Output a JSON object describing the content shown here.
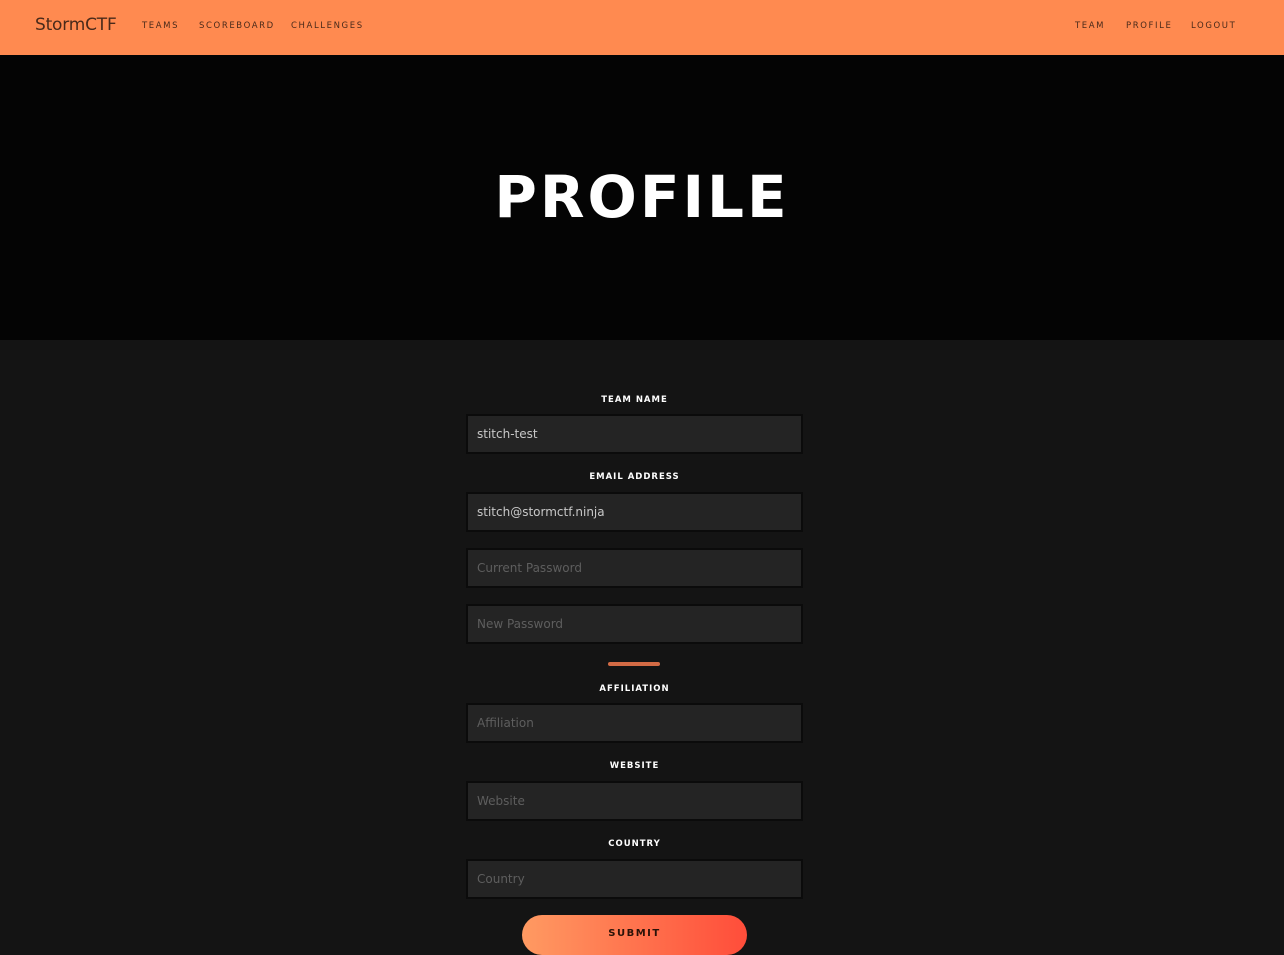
{
  "navbar": {
    "brand": "StormCTF",
    "left_links": [
      "TEAMS",
      "SCOREBOARD",
      "CHALLENGES"
    ],
    "right_links": [
      "TEAM",
      "PROFILE",
      "LOGOUT"
    ],
    "color": "#ff8a50"
  },
  "hero": {
    "title": "PROFILE"
  },
  "form": {
    "team_name_label": "TEAM NAME",
    "team_name_value": "stitch-test",
    "email_label": "EMAIL ADDRESS",
    "email_value": "stitch@stormctf.ninja",
    "current_password_placeholder": "Current Password",
    "new_password_placeholder": "New Password",
    "affiliation_label": "AFFILIATION",
    "affiliation_placeholder": "Affiliation",
    "website_label": "WEBSITE",
    "website_placeholder": "Website",
    "country_label": "COUNTRY",
    "country_placeholder": "Country",
    "submit_label": "SUBMIT"
  }
}
